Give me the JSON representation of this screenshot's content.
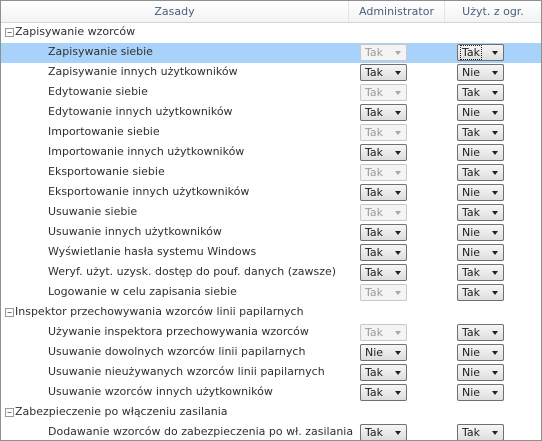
{
  "columns": {
    "policy": "Zasady",
    "admin": "Administrator",
    "user": "Użyt. z ogr."
  },
  "groups": [
    {
      "label": "Zapisywanie wzorców",
      "toggle": "−",
      "rows": [
        {
          "label": "Zapisywanie siebie",
          "admin": "Tak",
          "admin_enabled": false,
          "user": "Tak",
          "user_enabled": true,
          "selected": true,
          "user_focused": true
        },
        {
          "label": "Zapisywanie innych użytkowników",
          "admin": "Tak",
          "admin_enabled": true,
          "user": "Nie",
          "user_enabled": true
        },
        {
          "label": "Edytowanie siebie",
          "admin": "Tak",
          "admin_enabled": false,
          "user": "Tak",
          "user_enabled": true
        },
        {
          "label": "Edytowanie innych użytkowników",
          "admin": "Tak",
          "admin_enabled": true,
          "user": "Nie",
          "user_enabled": true
        },
        {
          "label": "Importowanie siebie",
          "admin": "Tak",
          "admin_enabled": false,
          "user": "Tak",
          "user_enabled": true
        },
        {
          "label": "Importowanie innych użytkowników",
          "admin": "Tak",
          "admin_enabled": true,
          "user": "Nie",
          "user_enabled": true
        },
        {
          "label": "Eksportowanie siebie",
          "admin": "Tak",
          "admin_enabled": false,
          "user": "Tak",
          "user_enabled": true
        },
        {
          "label": "Eksportowanie innych użytkowników",
          "admin": "Tak",
          "admin_enabled": true,
          "user": "Nie",
          "user_enabled": true
        },
        {
          "label": "Usuwanie siebie",
          "admin": "Tak",
          "admin_enabled": false,
          "user": "Tak",
          "user_enabled": true
        },
        {
          "label": "Usuwanie innych użytkowników",
          "admin": "Tak",
          "admin_enabled": true,
          "user": "Nie",
          "user_enabled": true
        },
        {
          "label": "Wyświetlanie hasła systemu Windows",
          "admin": "Tak",
          "admin_enabled": true,
          "user": "Nie",
          "user_enabled": true
        },
        {
          "label": "Weryf. użyt. uzysk. dostęp do pouf. danych (zawsze)",
          "admin": "Tak",
          "admin_enabled": true,
          "user": "Tak",
          "user_enabled": true
        },
        {
          "label": "Logowanie w celu zapisania siebie",
          "admin": "Tak",
          "admin_enabled": false,
          "user": "Tak",
          "user_enabled": true
        }
      ]
    },
    {
      "label": "Inspektor przechowywania wzorców linii papilarnych",
      "toggle": "−",
      "rows": [
        {
          "label": "Używanie inspektora przechowywania wzorców",
          "admin": "Tak",
          "admin_enabled": false,
          "user": "Tak",
          "user_enabled": true
        },
        {
          "label": "Usuwanie dowolnych wzorców linii papilarnych",
          "admin": "Nie",
          "admin_enabled": true,
          "user": "Nie",
          "user_enabled": true
        },
        {
          "label": "Usuwanie nieużywanych wzorców linii papilarnych",
          "admin": "Tak",
          "admin_enabled": true,
          "user": "Nie",
          "user_enabled": true
        },
        {
          "label": "Usuwanie wzorców innych użytkowników",
          "admin": "Tak",
          "admin_enabled": true,
          "user": "Nie",
          "user_enabled": true
        }
      ]
    },
    {
      "label": "Zabezpieczenie po włączeniu zasilania",
      "toggle": "−",
      "rows": [
        {
          "label": "Dodawanie wzorców do zabezpieczenia po wł. zasilania",
          "admin": "Tak",
          "admin_enabled": true,
          "user": "Tak",
          "user_enabled": true
        }
      ]
    }
  ],
  "colors": {
    "selection": "#a9d2fa",
    "header_text": "#4c607a",
    "border": "#8e8f8f"
  },
  "icons": {
    "group_toggle": "collapse-icon",
    "dropdown": "dropdown-arrow-icon"
  }
}
